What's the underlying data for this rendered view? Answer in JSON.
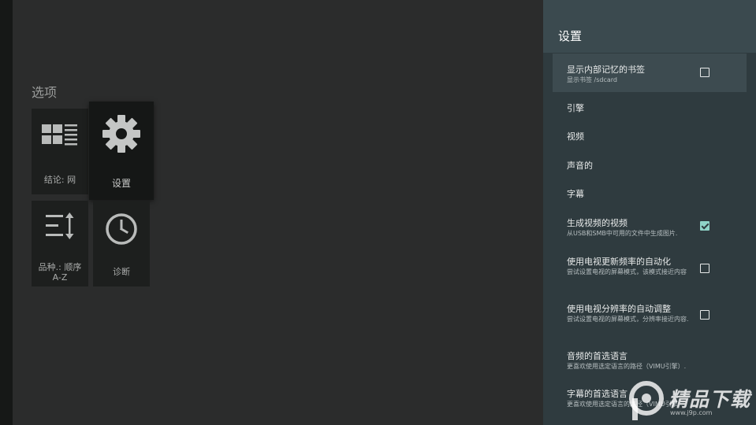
{
  "main": {
    "section_title": "选项",
    "tiles": [
      {
        "label": "结论: 网",
        "icon": "grid-list-icon"
      },
      {
        "label": "设置",
        "icon": "gear-icon"
      },
      {
        "label": "品种.: 顺序\nA-Z",
        "icon": "sort-icon"
      },
      {
        "label": "诊断",
        "icon": "clock-icon"
      }
    ]
  },
  "settings": {
    "title": "设置",
    "items": [
      {
        "title": "显示内部记忆的书签",
        "subtitle": "显示书签 /sdcard",
        "checkbox": true,
        "checked": false
      },
      {
        "title": "引擎"
      },
      {
        "title": "视频"
      },
      {
        "title": "声音的"
      },
      {
        "title": "字幕"
      },
      {
        "title": "生成视频的视频",
        "subtitle": "从USB和SMB中可用的文件中生成图片.",
        "checkbox": true,
        "checked": true
      },
      {
        "title": "使用电视更新频率的自动化",
        "subtitle": "尝试设置电视的屏幕模式，该模式接近内容",
        "checkbox": true,
        "checked": false
      },
      {
        "title": "使用电视分辨率的自动调整",
        "subtitle": "尝试设置电视的屏幕模式，分辨率接近内容.",
        "checkbox": true,
        "checked": false
      },
      {
        "title": "音频的首选语言",
        "subtitle": "更喜欢使用选定语言的路径（VIMU引擎）."
      },
      {
        "title": "字幕的首选语言",
        "subtitle": "更喜欢使用选定语言的路径（VIMU引擎"
      }
    ]
  },
  "watermark": {
    "text": "精品下载",
    "url": "www.j9p.com"
  },
  "colors": {
    "accent": "#8fd3c7",
    "panel": "#2f3b3f",
    "panel_header": "#3b4a4f",
    "background": "#2b2c2c"
  }
}
